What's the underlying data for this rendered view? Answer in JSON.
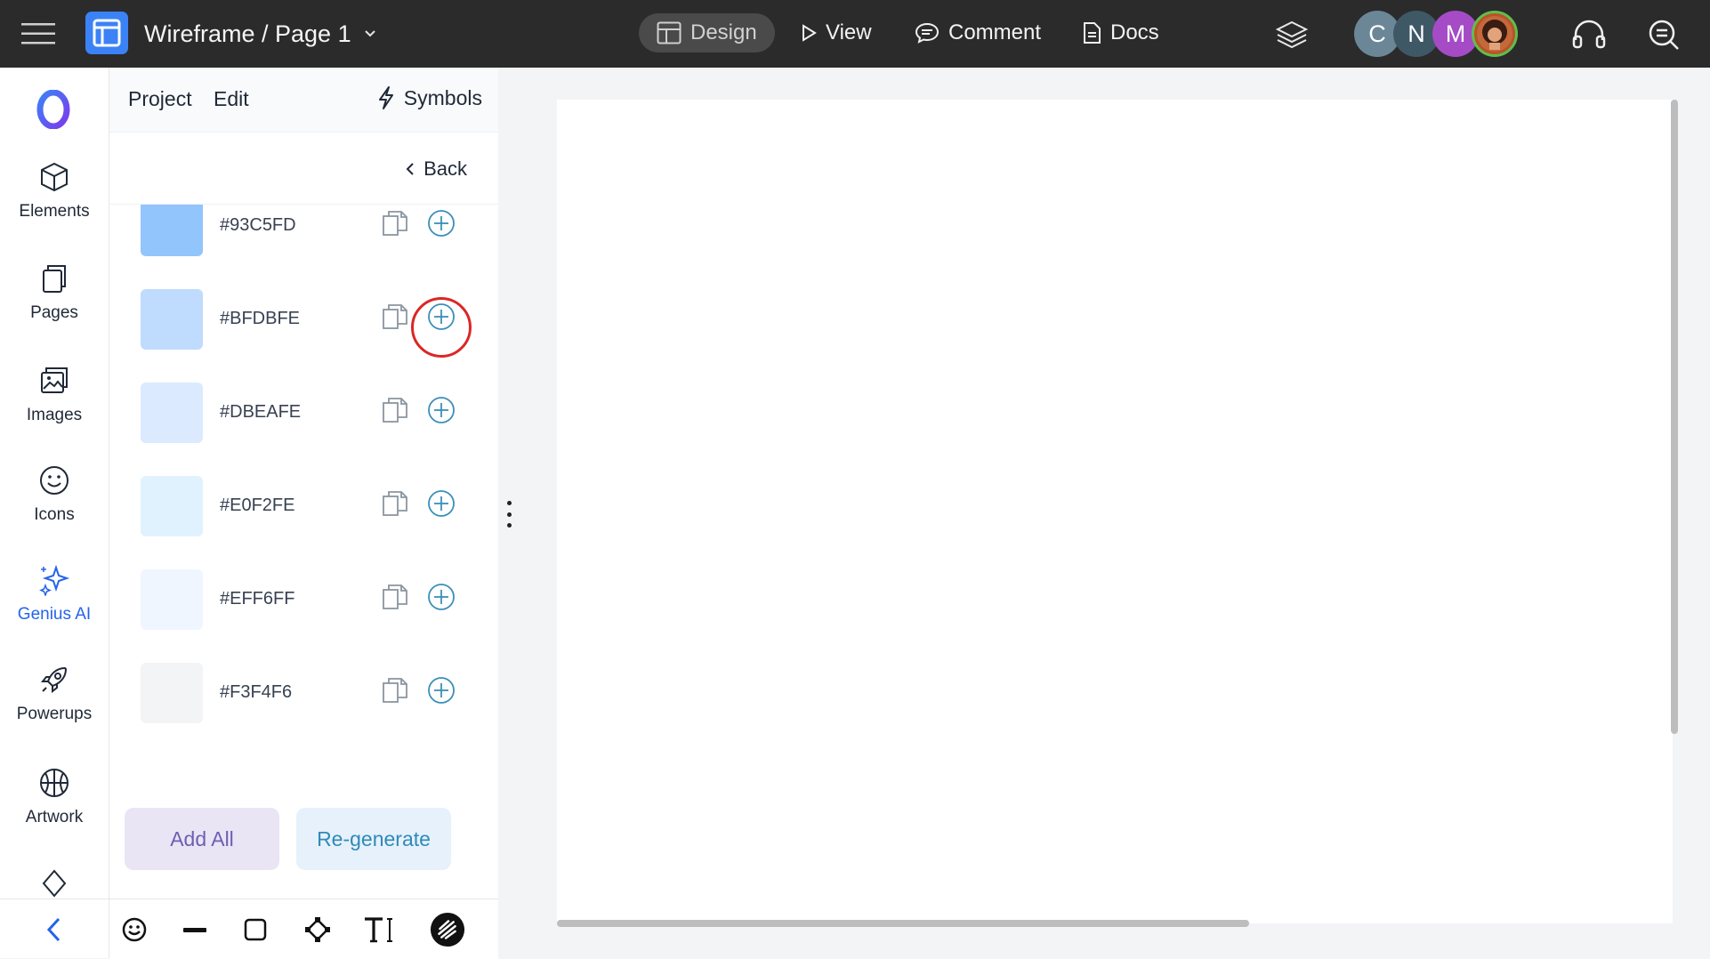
{
  "topbar": {
    "title": "Wireframe / Page 1",
    "nav": {
      "design": "Design",
      "view": "View",
      "comment": "Comment",
      "docs": "Docs"
    },
    "avatars": [
      {
        "letter": "C",
        "color": "#6b8797"
      },
      {
        "letter": "N",
        "color": "#3f5866"
      },
      {
        "letter": "M",
        "color": "#a54bc6"
      },
      {
        "letter": "",
        "color": "#b9532a"
      }
    ]
  },
  "rail": {
    "items": [
      {
        "label": "Elements",
        "icon": "cube-icon"
      },
      {
        "label": "Pages",
        "icon": "pages-icon"
      },
      {
        "label": "Images",
        "icon": "image-icon"
      },
      {
        "label": "Icons",
        "icon": "smiley-icon"
      },
      {
        "label": "Genius AI",
        "icon": "sparkle-icon"
      },
      {
        "label": "Powerups",
        "icon": "rocket-icon"
      },
      {
        "label": "Artwork",
        "icon": "basketball-icon"
      }
    ]
  },
  "panel": {
    "tabs": {
      "project": "Project",
      "edit": "Edit",
      "symbols": "Symbols"
    },
    "back": "Back",
    "colors": [
      {
        "hex": "#93C5FD"
      },
      {
        "hex": "#BFDBFE"
      },
      {
        "hex": "#DBEAFE"
      },
      {
        "hex": "#E0F2FE"
      },
      {
        "hex": "#EFF6FF"
      },
      {
        "hex": "#F3F4F6"
      }
    ],
    "add_all": "Add All",
    "regenerate": "Re-generate"
  },
  "accent": "#2563eb"
}
